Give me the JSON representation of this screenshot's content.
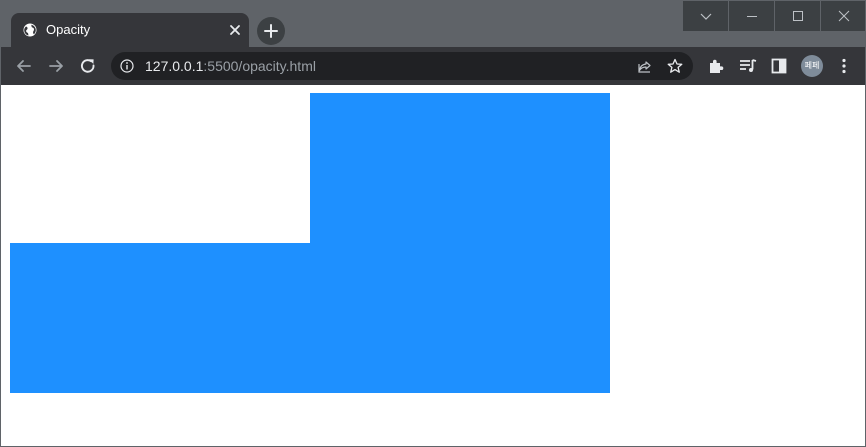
{
  "browser": {
    "tab": {
      "title": "Opacity",
      "favicon": "globe-icon",
      "close_icon": "close-icon"
    },
    "new_tab_icon": "plus-icon",
    "window_controls": [
      "chevron-down-icon",
      "minimize-icon",
      "maximize-icon",
      "close-icon"
    ],
    "toolbar": {
      "back_icon": "arrow-left-icon",
      "forward_icon": "arrow-right-icon",
      "reload_icon": "reload-icon",
      "address": {
        "host": "127.0.0.1",
        "path": ":5500/opacity.html"
      },
      "info_icon": "info-icon",
      "share_icon": "share-icon",
      "bookmark_icon": "star-icon",
      "extensions_icon": "puzzle-icon",
      "media_icon": "media-queue-icon",
      "side_panel_icon": "side-panel-icon",
      "profile": {
        "label": "페페"
      },
      "menu_icon": "kebab-menu-icon"
    }
  },
  "page": {
    "boxes": [
      {
        "name": "blue-box-1",
        "color": "#1e90ff"
      },
      {
        "name": "blue-box-2",
        "color": "#1e90ff"
      }
    ]
  },
  "colors": {
    "tab_strip": "#5f6368",
    "toolbar": "#35363a",
    "omnibox": "#202124",
    "box": "#1e90ff"
  }
}
